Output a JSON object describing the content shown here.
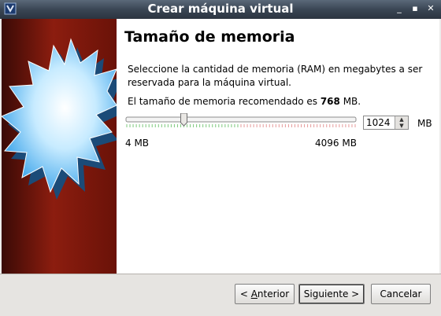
{
  "window": {
    "title": "Crear máquina virtual"
  },
  "page": {
    "heading": "Tamaño de memoria",
    "description": "Seleccione la cantidad de memoria (RAM) en megabytes a ser reservada para la máquina virtual.",
    "recommended_prefix": "El tamaño de memoria recomendado es ",
    "recommended_value": "768",
    "recommended_suffix": " MB.",
    "memory_value": "1024",
    "unit": "MB",
    "slider_min_label": "4 MB",
    "slider_max_label": "4096 MB",
    "slider_value_fraction": 0.25
  },
  "buttons": {
    "back": "Anterior",
    "back_mnemonic": "A",
    "next": "Siguiente >",
    "cancel": "Cancelar"
  },
  "icons": {
    "app": "virtualbox-icon",
    "minimize": "minimize-icon",
    "maximize": "maximize-icon",
    "close": "close-icon"
  }
}
